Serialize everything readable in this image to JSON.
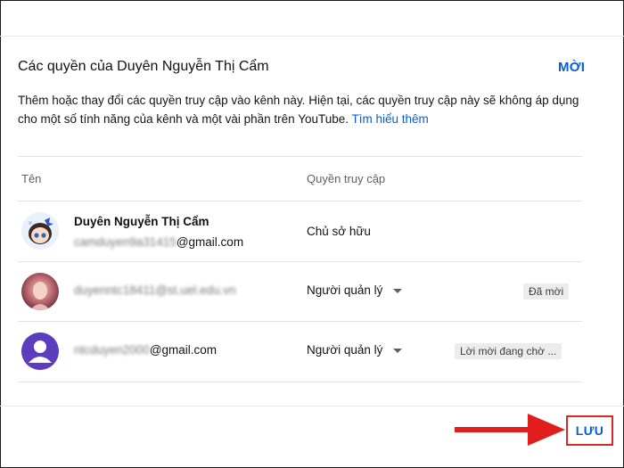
{
  "dialog": {
    "title": "Các quyền của Duyên Nguyễn Thị Cẩm",
    "invite_label": "MỜI",
    "description": "Thêm hoặc thay đổi các quyền truy cập vào kênh này. Hiện tại, các quyền truy cập này sẽ không áp dụng cho một số tính năng của kênh và một vài phần trên YouTube.",
    "learn_more": "Tìm hiểu thêm"
  },
  "table": {
    "headers": {
      "name": "Tên",
      "access": "Quyền truy cập"
    },
    "rows": [
      {
        "name": "Duyên Nguyễn Thị Cẩm",
        "email_user": "camduyen9a31415",
        "email_domain": "@gmail.com",
        "role": "Chủ sở hữu",
        "avatar": "cartoon-girl-avatar"
      },
      {
        "email_user": "duyenntc18411@st.uel.edu.vn",
        "role": "Người quản lý",
        "status": "Đã mời",
        "avatar": "photo-avatar"
      },
      {
        "email_user": "ntcduyen2000",
        "email_domain": "@gmail.com",
        "role": "Người quản lý",
        "status": "Lời mời đang chờ ...",
        "avatar": "default-person-avatar"
      }
    ]
  },
  "footer": {
    "save_label": "LƯU"
  },
  "colors": {
    "accent": "#065fd4",
    "highlight": "#d62828",
    "avatar_default": "#5c3dbd"
  }
}
